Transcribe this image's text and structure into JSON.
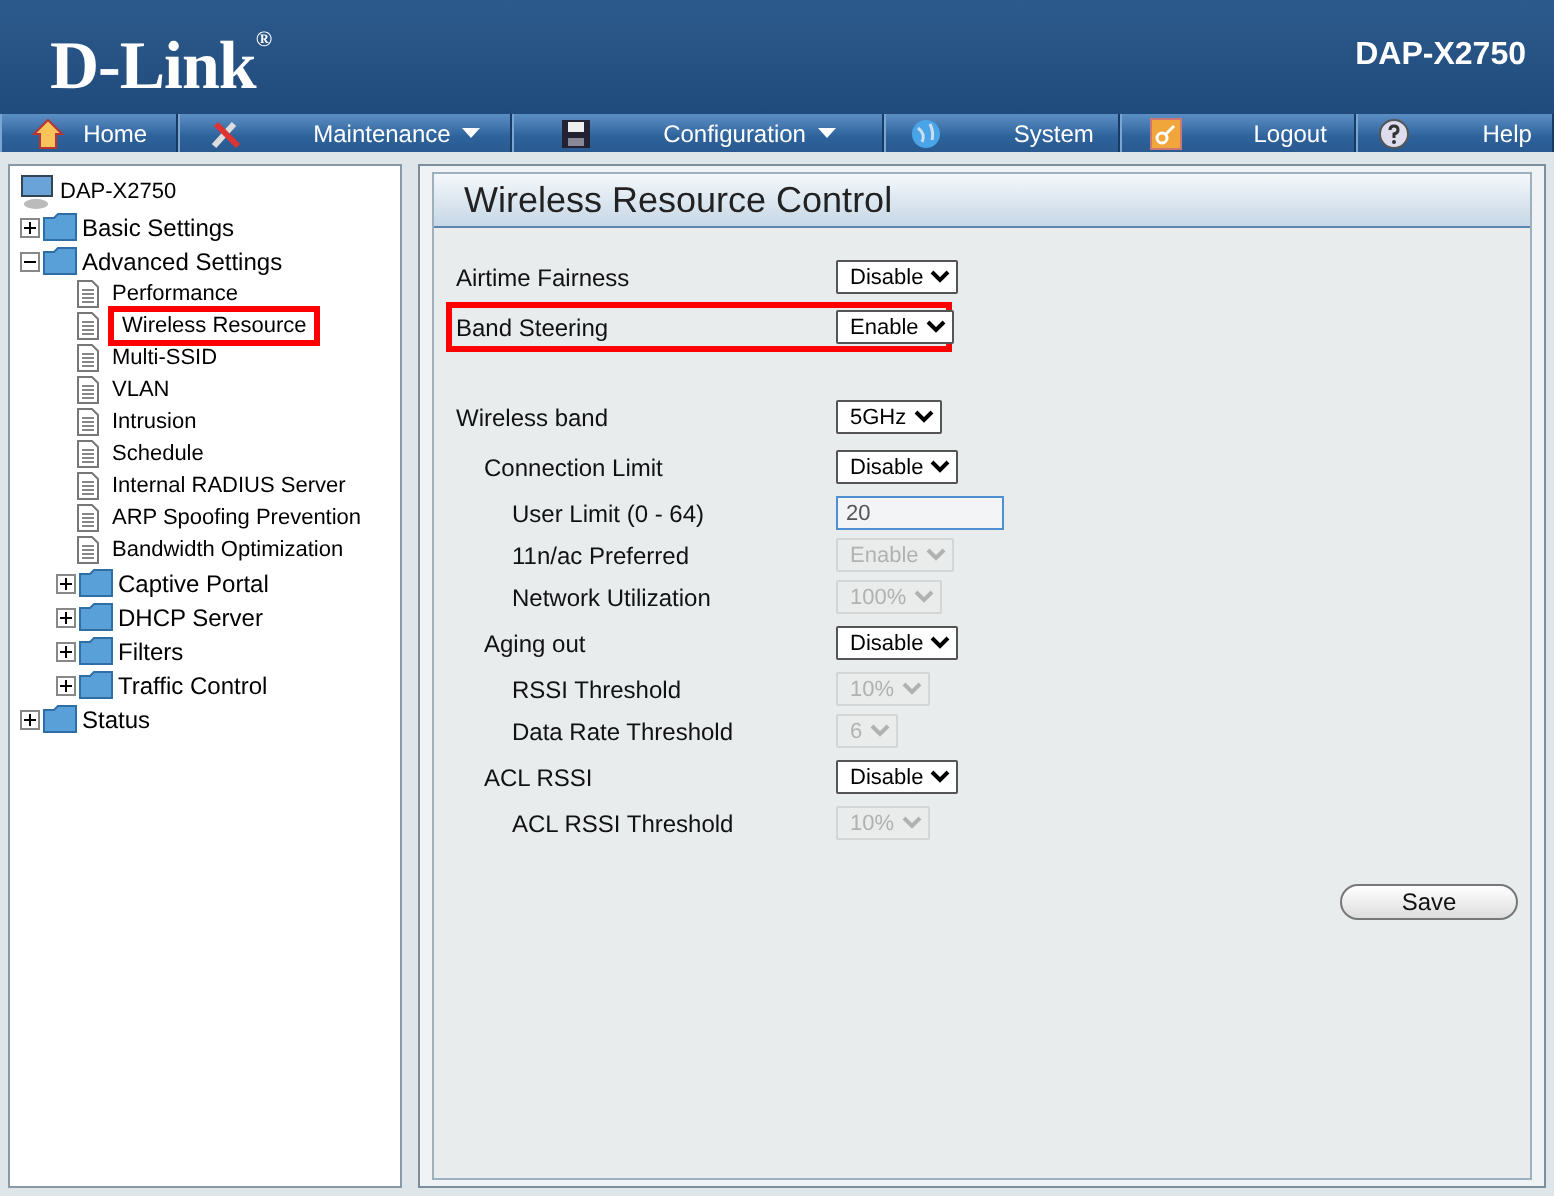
{
  "header": {
    "logo": "D-Link$^{®}$",
    "model": "DAP-X2750"
  },
  "nav": [
    {
      "label": "Home",
      "has_menu": false
    },
    {
      "label": "Maintenance",
      "has_menu": true
    },
    {
      "label": "Configuration",
      "has_menu": true
    },
    {
      "label": "System",
      "has_menu": false
    },
    {
      "label": "Logout",
      "has_menu": false
    },
    {
      "label": "Help",
      "has_menu": false
    }
  ],
  "sidebar": {
    "root": "DAP-X2750",
    "items": [
      {
        "label": "Basic Settings",
        "kind": "folder",
        "expanded": false
      },
      {
        "label": "Advanced Settings",
        "kind": "folder",
        "expanded": true,
        "children": [
          {
            "label": "Performance",
            "kind": "page",
            "highlighted": false
          },
          {
            "label": "Wireless Resource",
            "kind": "page",
            "highlighted": true
          },
          {
            "label": "Multi-SSID",
            "kind": "page",
            "highlighted": false
          },
          {
            "label": "VLAN",
            "kind": "page",
            "highlighted": false
          },
          {
            "label": "Intrusion",
            "kind": "page",
            "highlighted": false
          },
          {
            "label": "Schedule",
            "kind": "page",
            "highlighted": false
          },
          {
            "label": "Internal RADIUS Server",
            "kind": "page",
            "highlighted": false
          },
          {
            "label": "ARP Spoofing Prevention",
            "kind": "page",
            "highlighted": false
          },
          {
            "label": "Bandwidth Optimization",
            "kind": "page",
            "highlighted": false
          },
          {
            "label": "Captive Portal",
            "kind": "folder",
            "expanded": false
          },
          {
            "label": "DHCP Server",
            "kind": "folder",
            "expanded": false
          },
          {
            "label": "Filters",
            "kind": "folder",
            "expanded": false
          },
          {
            "label": "Traffic Control",
            "kind": "folder",
            "expanded": false
          }
        ]
      },
      {
        "label": "Status",
        "kind": "folder",
        "expanded": false
      }
    ]
  },
  "panel": {
    "title": "Wireless Resource Control",
    "sections": [
      [
        {
          "label": "Airtime Fairness",
          "kind": "select",
          "value": "Disable",
          "disabled": false,
          "highlighted": false
        },
        {
          "label": "Band Steering",
          "kind": "select",
          "value": "Enable",
          "disabled": false,
          "highlighted": true
        }
      ],
      [
        {
          "label": "Wireless band",
          "kind": "select",
          "value": "5GHz",
          "disabled": false,
          "highlighted": false,
          "children": [
            {
              "label": "Connection Limit",
              "kind": "select",
              "value": "Disable",
              "disabled": false,
              "highlighted": false,
              "children": [
                {
                  "label": "User Limit (0 - 64)",
                  "kind": "text",
                  "value": "20",
                  "highlighted": false
                },
                {
                  "label": "11n/ac Preferred",
                  "kind": "select",
                  "value": "Enable",
                  "disabled": true,
                  "highlighted": false
                },
                {
                  "label": "Network Utilization",
                  "kind": "select",
                  "value": "100%",
                  "disabled": true,
                  "highlighted": false
                }
              ]
            },
            {
              "label": "Aging out",
              "kind": "select",
              "value": "Disable",
              "disabled": false,
              "highlighted": false,
              "children": [
                {
                  "label": "RSSI Threshold",
                  "kind": "select",
                  "value": "10%",
                  "disabled": true,
                  "highlighted": false
                },
                {
                  "label": "Data Rate Threshold",
                  "kind": "select",
                  "value": "6",
                  "disabled": true,
                  "highlighted": false
                }
              ]
            },
            {
              "label": "ACL RSSI",
              "kind": "select",
              "value": "Disable",
              "disabled": false,
              "highlighted": false,
              "children": [
                {
                  "label": "ACL RSSI Threshold",
                  "kind": "select",
                  "value": "10%",
                  "disabled": true,
                  "highlighted": false
                }
              ]
            }
          ]
        }
      ]
    ],
    "save": "Save"
  }
}
